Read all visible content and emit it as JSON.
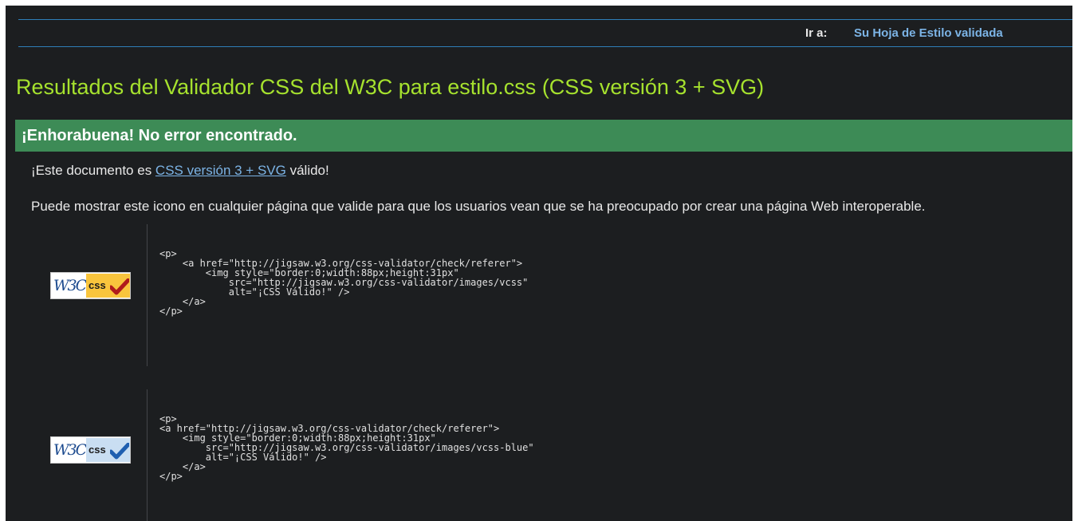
{
  "nav": {
    "label": "Ir a:",
    "link": "Su Hoja de Estilo validada"
  },
  "title": "Resultados del Validador CSS del W3C para estilo.css (CSS versión 3 + SVG)",
  "banner": "¡Enhorabuena! No error encontrado.",
  "valid": {
    "prefix": "¡Este documento es ",
    "link": "CSS versión 3 + SVG",
    "suffix": " válido!"
  },
  "info": "Puede mostrar este icono en cualquier página que valide para que los usuarios vean que se ha preocupado por crear una página Web interoperable.",
  "badges": [
    {
      "logo_text": "W3C",
      "css_text": "css",
      "icon": "check-red-icon",
      "color": "#f9c53d",
      "code": "<p>\n    <a href=\"http://jigsaw.w3.org/css-validator/check/referer\">\n        <img style=\"border:0;width:88px;height:31px\"\n            src=\"http://jigsaw.w3.org/css-validator/images/vcss\"\n            alt=\"¡CSS Válido!\" />\n    </a>\n</p>"
    },
    {
      "logo_text": "W3C",
      "css_text": "css",
      "icon": "check-blue-icon",
      "color": "#c9def2",
      "code": "<p>\n<a href=\"http://jigsaw.w3.org/css-validator/check/referer\">\n    <img style=\"border:0;width:88px;height:31px\"\n        src=\"http://jigsaw.w3.org/css-validator/images/vcss-blue\"\n        alt=\"¡CSS Válido!\" />\n    </a>\n</p>"
    }
  ],
  "colors": {
    "background": "#1c1e20",
    "title": "#a6e22e",
    "banner": "#3d8b56",
    "link": "#7cb4e6"
  }
}
